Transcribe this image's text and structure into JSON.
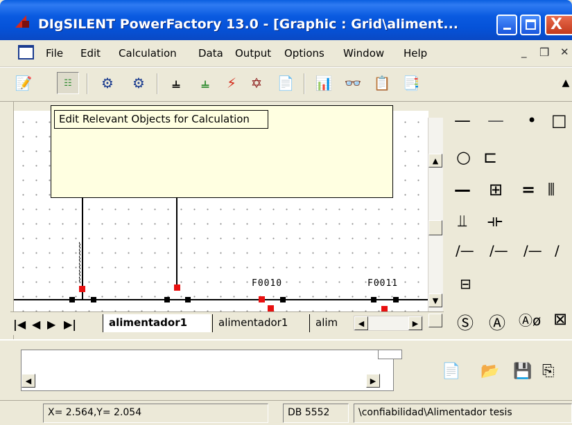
{
  "window": {
    "title": "DIgSILENT PowerFactory 13.0 - [Graphic : Grid\\aliment...",
    "minimize_glyph": "",
    "maximize_glyph": "",
    "close_glyph": "X"
  },
  "menu": {
    "items": [
      "File",
      "Edit",
      "Calculation",
      "Data",
      "Output",
      "Options",
      "Window",
      "Help"
    ],
    "mdi_minimize": "_",
    "mdi_restore": "&#x25A1;"
  },
  "tooltip": {
    "text": "Edit Relevant Objects for Calculation"
  },
  "canvas": {
    "bus_labels": [
      "F0010",
      "F0011"
    ]
  },
  "tabs": {
    "items": [
      "alimentador1",
      "alimentador1",
      "alim"
    ],
    "active_index": 0
  },
  "status": {
    "coords": "X=    2.564,Y=    2.054",
    "db": "DB 5552",
    "path": "\\confiabilidad\\Alimentador tesis"
  },
  "colors": {
    "titlebar": "#0a5ae0",
    "node_red": "#e81010",
    "palette_green": "#2e8b2e",
    "palette_red": "#8b1a1a",
    "tooltip_bg": "#ffffe1"
  }
}
